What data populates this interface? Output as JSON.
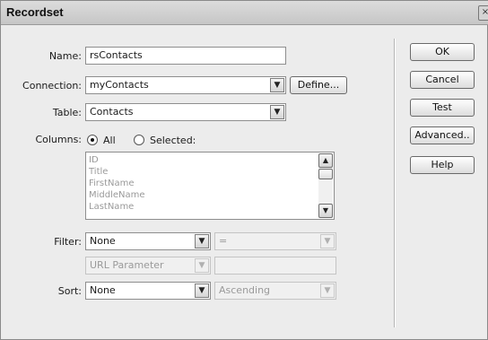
{
  "window": {
    "title": "Recordset",
    "close_glyph": "×"
  },
  "form": {
    "name_label": "Name:",
    "name_value": "rsContacts",
    "connection_label": "Connection:",
    "connection_value": "myContacts",
    "define_label": "Define...",
    "table_label": "Table:",
    "table_value": "Contacts",
    "columns_label": "Columns:",
    "all_label": "All",
    "selected_label": "Selected:",
    "columns_selected_option": "All",
    "columns_list": [
      "ID",
      "Title",
      "FirstName",
      "MiddleName",
      "LastName"
    ],
    "filter_label": "Filter:",
    "filter_column": "None",
    "filter_operator": "=",
    "filter_source": "URL Parameter",
    "filter_value": "",
    "sort_label": "Sort:",
    "sort_column": "None",
    "sort_order": "Ascending"
  },
  "buttons": {
    "ok": "OK",
    "cancel": "Cancel",
    "test": "Test",
    "advanced": "Advanced..",
    "help": "Help"
  },
  "icons": {
    "dropdown": "▼",
    "scroll_up": "▲",
    "scroll_down": "▼"
  }
}
